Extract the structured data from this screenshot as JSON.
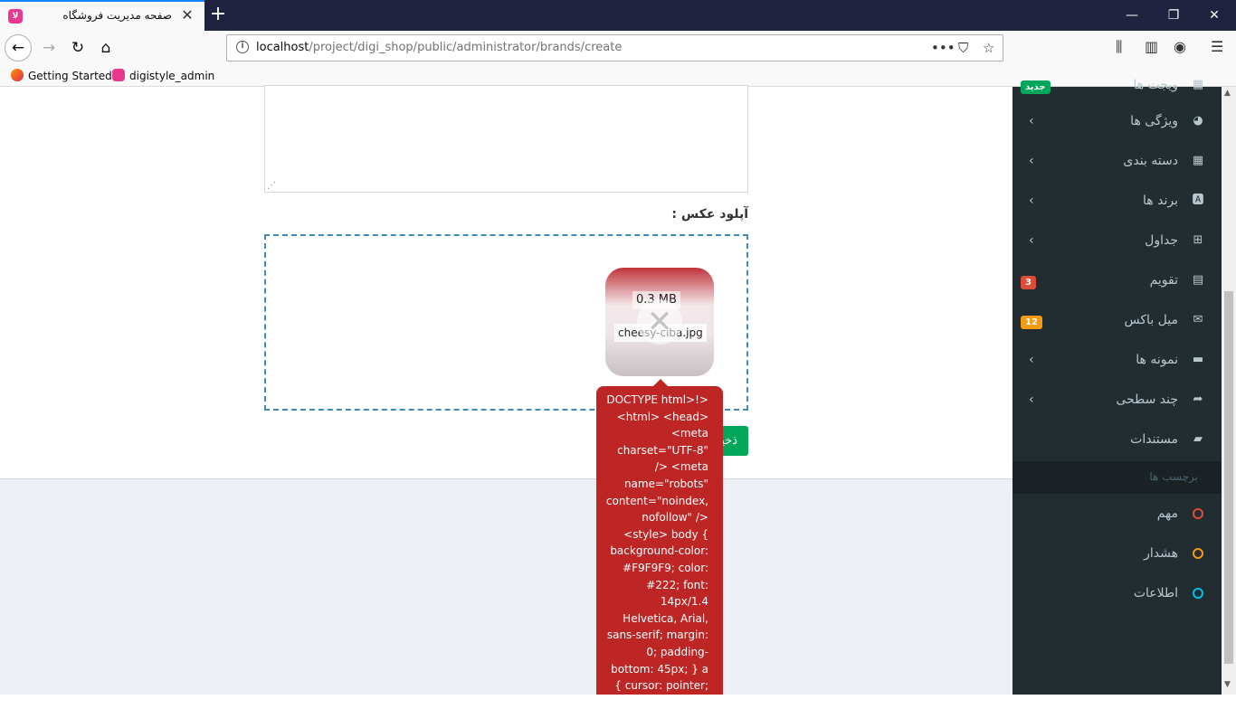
{
  "browser": {
    "tab_title": "صفحه مدیریت فروشگاه",
    "tab_favicon": "digistyle-favicon",
    "url_host": "localhost",
    "url_path": "/project/digi_shop/public/administrator/brands/create",
    "bookmarks": [
      {
        "label": "Getting Started",
        "icon": "firefox-icon"
      },
      {
        "label": "digistyle_admin",
        "icon": "digistyle-icon"
      }
    ]
  },
  "form": {
    "upload_label": "آپلود عکس :",
    "file_size": "0.3 MB",
    "file_name": "cheesy-ciba.jpg",
    "save_label": "ذخیره",
    "error_message": "<!DOCTYPE html> <html> <head> <meta charset=\"UTF-8\" /> <meta name=\"robots\" content=\"noindex,nofollow\" /> <style> body { background-color: #F9F9F9; color: #222; font: 14px/1.4 Helvetica, Arial, sans-serif; margin: 0; padding-bottom: 45px; } a { cursor: pointer; text-decoration: none; }"
  },
  "sidebar": {
    "items": [
      {
        "label": "ویجت ها",
        "icon": "th-icon",
        "badge": "جدید",
        "badge_color": "#00a65a"
      },
      {
        "label": "ویژگی ها",
        "icon": "pie-chart-icon",
        "chevron": true
      },
      {
        "label": "دسته بندی",
        "icon": "grid-icon",
        "chevron": true
      },
      {
        "label": "برند ها",
        "icon": "font-icon",
        "chevron": true
      },
      {
        "label": "جداول",
        "icon": "table-icon",
        "chevron": true
      },
      {
        "label": "تقویم",
        "icon": "calendar-icon",
        "badge": "3",
        "badge_color": "#dd4b39"
      },
      {
        "label": "میل باکس",
        "icon": "envelope-icon",
        "badge": "12",
        "badge_color": "#f39c12"
      },
      {
        "label": "نمونه ها",
        "icon": "folder-icon",
        "chevron": true
      },
      {
        "label": "چند سطحی",
        "icon": "share-icon",
        "chevron": true
      },
      {
        "label": "مستندات",
        "icon": "book-icon"
      }
    ],
    "section_header": "برچسب ها",
    "labels": [
      {
        "label": "مهم",
        "color": "#dd4b39"
      },
      {
        "label": "هشدار",
        "color": "#f39c12"
      },
      {
        "label": "اطلاعات",
        "color": "#00c0ef"
      }
    ]
  }
}
